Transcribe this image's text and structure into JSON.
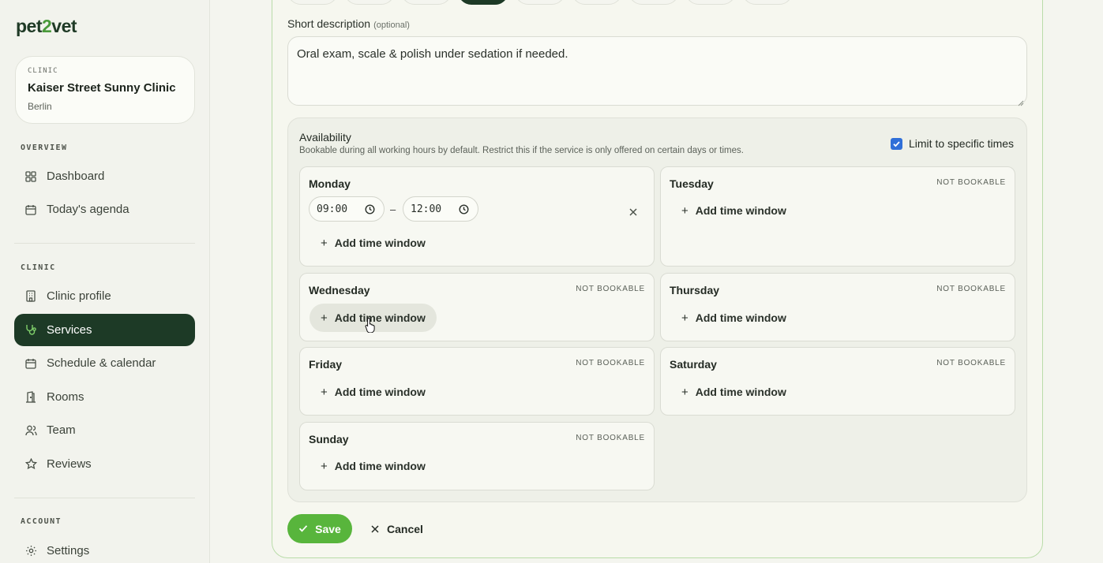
{
  "brand": {
    "name_a": "pet",
    "name_b": "2",
    "name_c": "vet"
  },
  "clinic_card": {
    "caption": "CLINIC",
    "name": "Kaiser Street Sunny Clinic",
    "city": "Berlin"
  },
  "sidebar": {
    "overview_label": "OVERVIEW",
    "clinic_label": "CLINIC",
    "account_label": "ACCOUNT",
    "items": {
      "dashboard": "Dashboard",
      "agenda": "Today's agenda",
      "clinic_profile": "Clinic profile",
      "services": "Services",
      "schedule": "Schedule & calendar",
      "rooms": "Rooms",
      "team": "Team",
      "reviews": "Reviews",
      "settings": "Settings"
    }
  },
  "form": {
    "short_desc_label": "Short description",
    "short_desc_optional": "(optional)",
    "short_desc_value": "Oral exam, scale & polish under sedation if needed."
  },
  "availability": {
    "title": "Availability",
    "description": "Bookable during all working hours by default. Restrict this if the service is only offered on certain days or times.",
    "limit_label": "Limit to specific times",
    "limit_checked": true,
    "not_bookable": "NOT BOOKABLE",
    "add_label": "Add time window",
    "days": {
      "monday": {
        "name": "Monday",
        "start": "09:00",
        "end": "12:00",
        "dash": "–"
      },
      "tuesday": {
        "name": "Tuesday"
      },
      "wednesday": {
        "name": "Wednesday"
      },
      "thursday": {
        "name": "Thursday"
      },
      "friday": {
        "name": "Friday"
      },
      "saturday": {
        "name": "Saturday"
      },
      "sunday": {
        "name": "Sunday"
      }
    }
  },
  "actions": {
    "save": "Save",
    "cancel": "Cancel"
  },
  "colors": {
    "accent": "#58b53c",
    "active_nav": "#1d3a26",
    "checkbox": "#2f6fd8"
  }
}
